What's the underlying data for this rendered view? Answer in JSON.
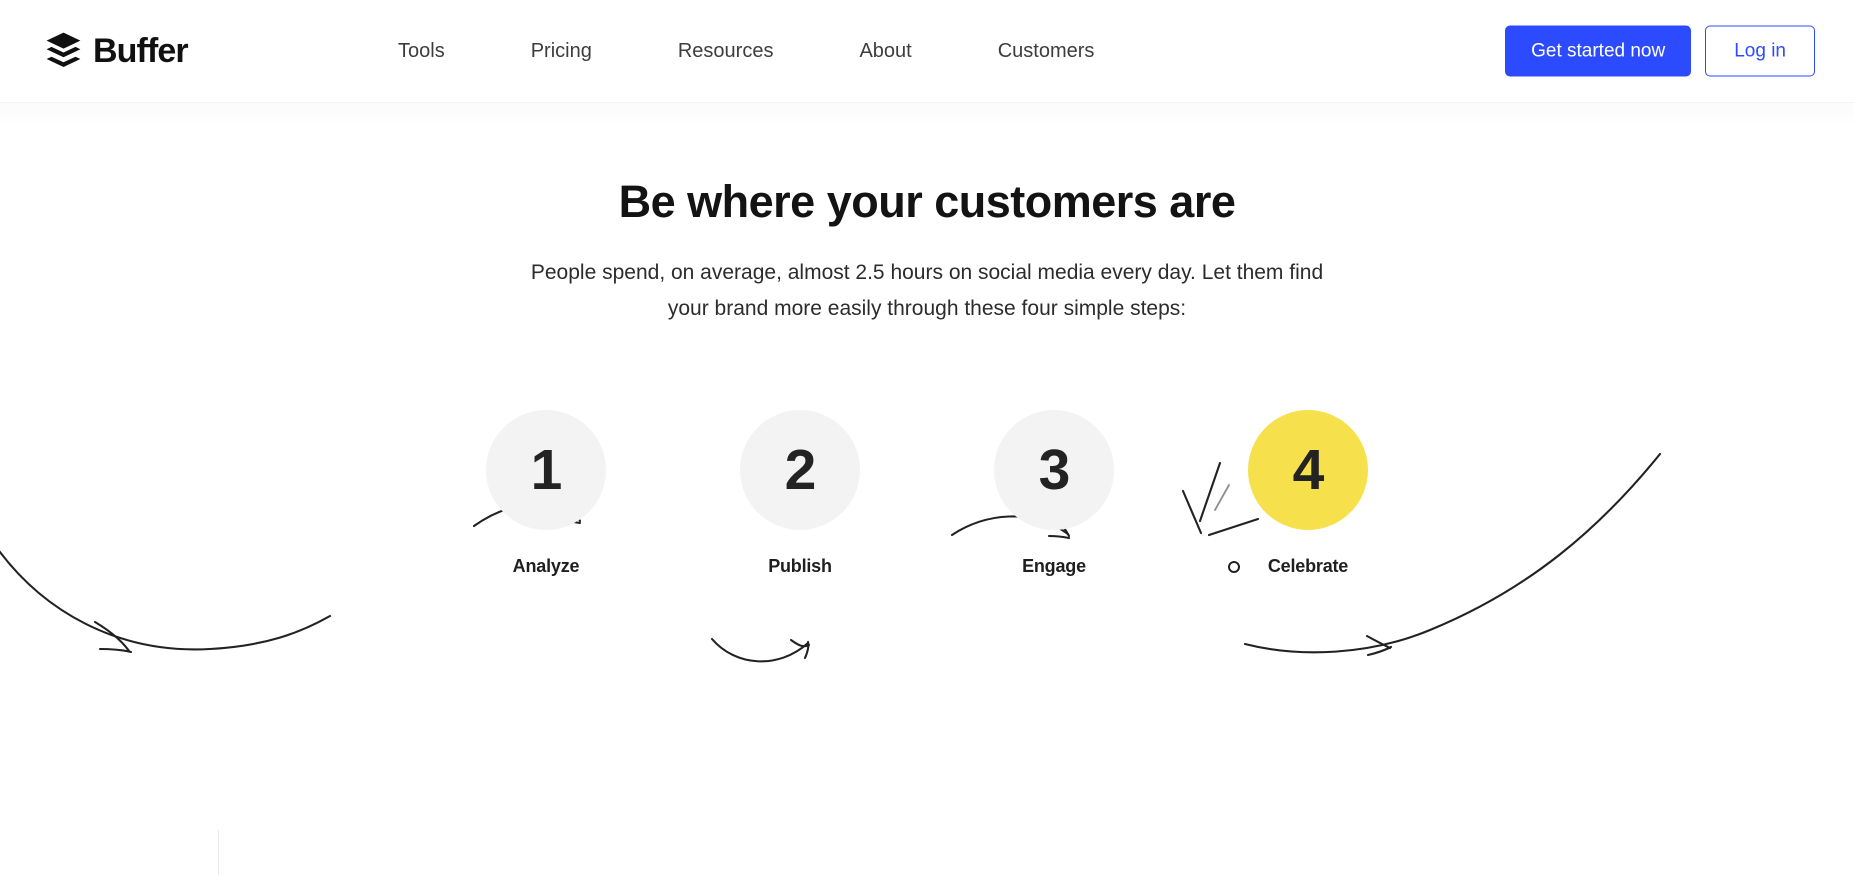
{
  "brand": {
    "name": "Buffer",
    "logo_icon": "buffer-stacked-layers-icon"
  },
  "nav": {
    "items": [
      {
        "label": "Tools"
      },
      {
        "label": "Pricing"
      },
      {
        "label": "Resources"
      },
      {
        "label": "About"
      },
      {
        "label": "Customers"
      }
    ]
  },
  "header_actions": {
    "primary_label": "Get started now",
    "secondary_label": "Log in"
  },
  "hero": {
    "title": "Be where your customers are",
    "subtitle": "People spend, on average, almost 2.5 hours on social media every day. Let them find your brand more easily through these four simple steps:"
  },
  "steps": [
    {
      "number": "1",
      "label": "Analyze",
      "highlight": false
    },
    {
      "number": "2",
      "label": "Publish",
      "highlight": false
    },
    {
      "number": "3",
      "label": "Engage",
      "highlight": false
    },
    {
      "number": "4",
      "label": "Celebrate",
      "highlight": true
    }
  ],
  "decorations": {
    "arrow_left_icon": "curved-arrow-right-icon",
    "arrow_one_to_two_icon": "curved-arrow-right-icon",
    "arrow_two_to_three_icon": "curved-arrow-up-right-icon",
    "arrow_three_to_four_icon": "curved-arrow-right-icon",
    "arrow_right_icon": "curved-arrow-right-icon",
    "sparkle_icon": "celebration-burst-icon"
  },
  "colors": {
    "accent_blue": "#2c4bff",
    "highlight_yellow": "#f6e04b",
    "circle_gray": "#f3f3f3",
    "text_dark": "#131313",
    "stroke_dark": "#222222"
  }
}
